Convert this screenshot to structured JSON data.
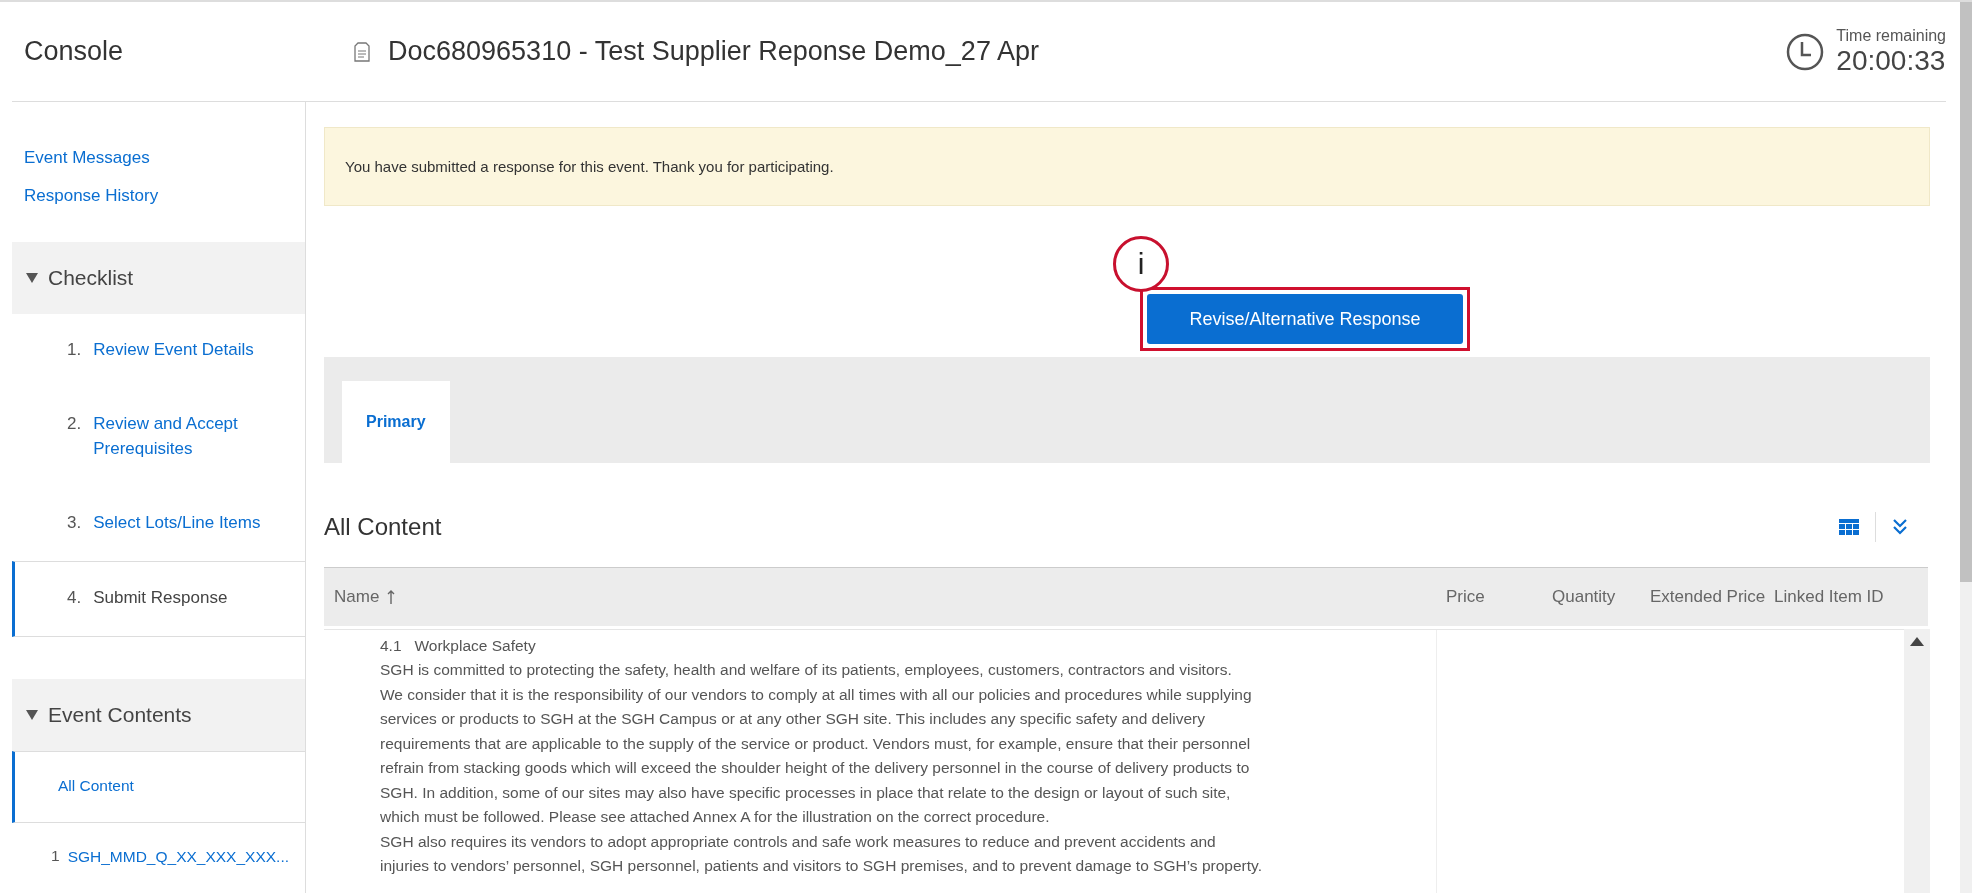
{
  "header": {
    "console_title": "Console",
    "document_title": "Doc680965310 - Test Supplier Reponse Demo_27 Apr",
    "timer_label": "Time remaining",
    "timer_value": "20:00:33"
  },
  "sidebar": {
    "links": [
      "Event Messages",
      "Response History"
    ],
    "checklist": {
      "title": "Checklist",
      "expanded": true,
      "items": [
        {
          "number": "1.",
          "label": "Review Event Details",
          "selected": false
        },
        {
          "number": "2.",
          "label": "Review and Accept Prerequisites",
          "selected": false
        },
        {
          "number": "3.",
          "label": "Select Lots/Line Items",
          "selected": false
        },
        {
          "number": "4.",
          "label": "Submit Response",
          "selected": true
        }
      ]
    },
    "event_contents": {
      "title": "Event Contents",
      "expanded": true,
      "items": [
        {
          "label": "All Content",
          "selected": true
        },
        {
          "number": "1",
          "label": "SGH_MMD_Q_XX_XXX_XXX...",
          "selected": false
        }
      ]
    }
  },
  "banner": {
    "message": "You have submitted a response for this event.  Thank you for participating."
  },
  "annotation": {
    "label": "i"
  },
  "revise_button": {
    "label": "Revise/Alternative Response",
    "highlighted": true
  },
  "tabs": [
    {
      "label": "Primary",
      "selected": true
    }
  ],
  "section_title": "All Content",
  "table": {
    "columns": [
      {
        "label": "Name",
        "sorted": true
      },
      {
        "label": "Price",
        "sorted": false
      },
      {
        "label": "Quantity",
        "sorted": false
      },
      {
        "label": "Extended Price",
        "sorted": false
      },
      {
        "label": "Linked Item ID",
        "sorted": false
      }
    ],
    "rows": [
      {
        "number": "4.1",
        "title": "Workplace Safety",
        "lines": [
          "SGH is committed to protecting the safety, health and welfare of its patients, employees, customers, contractors and visitors.",
          "We consider that it is the responsibility of our vendors to comply at all times with all our policies and procedures while supplying",
          "services or products to SGH at the SGH Campus or at any other SGH site. This includes any specific safety and delivery",
          "requirements that are applicable to the supply of the service or product. Vendors must, for example, ensure that their personnel",
          "refrain from stacking goods which will exceed the shoulder height of the delivery personnel in the course of delivery products to",
          "SGH. In addition, some of our sites may also have specific processes in place that relate to the design or layout of such site,",
          "which must be followed. Please see attached Annex A for the illustration on the correct procedure.",
          "SGH also requires its vendors to adopt appropriate controls and safe work measures to reduce and prevent accidents and",
          "injuries to vendors’ personnel, SGH personnel, patients and visitors to SGH premises, and to prevent damage to SGH’s property."
        ]
      }
    ]
  }
}
